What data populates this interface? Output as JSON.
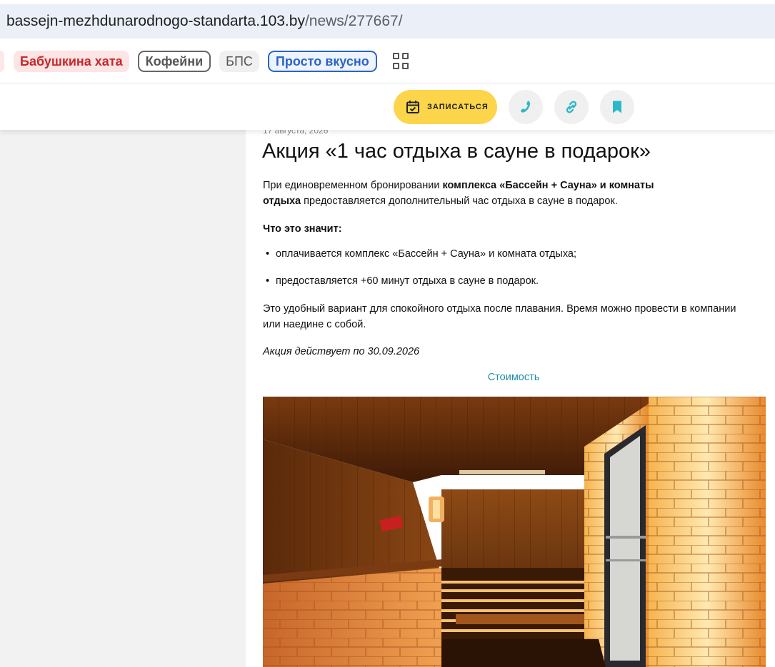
{
  "browser": {
    "url_host": "bassejn-mezhdunarodnogo-standarta.103.by",
    "url_path": "/news/277667/"
  },
  "tags": [
    {
      "label": "Бабушкина хата"
    },
    {
      "label": "Кофейни"
    },
    {
      "label": "БПС"
    },
    {
      "label": "Просто вкусно"
    }
  ],
  "actions": {
    "book_label": "ЗАПИСАТЬСЯ",
    "phone_icon": "phone-icon",
    "link_icon": "link-icon",
    "bookmark_icon": "bookmark-icon"
  },
  "article": {
    "date": "17 августа, 2026",
    "title": "Акция «1 час отдыха в сауне в подарок»",
    "intro_pre": "При единовременном бронировании ",
    "intro_bold_1": "комплекса «Бассейн + Сауна» и комнаты",
    "intro_bold_2": "отдыха",
    "intro_post": " предоставляется дополнительный час отдыха в сауне в подарок.",
    "what_heading": "Что это значит:",
    "bullets": [
      "оплачивается комплекс «Бассейн + Сауна» и комната отдыха;",
      "предоставляется +60 минут отдыха в сауне в подарок."
    ],
    "body_line_1": "Это удобный вариант для спокойного отдыха после плавания. Время можно провести в компании",
    "body_line_2": "или наедине с собой.",
    "valid_until": "Акция действует по 30.09.2026",
    "price_link": "Стоимость"
  },
  "colors": {
    "accent_yellow": "#fdd54a",
    "icon_teal": "#2bb8c9",
    "link_teal": "#1f8fa6",
    "tag_red": "#c62828",
    "tag_blue": "#2c63c9"
  }
}
